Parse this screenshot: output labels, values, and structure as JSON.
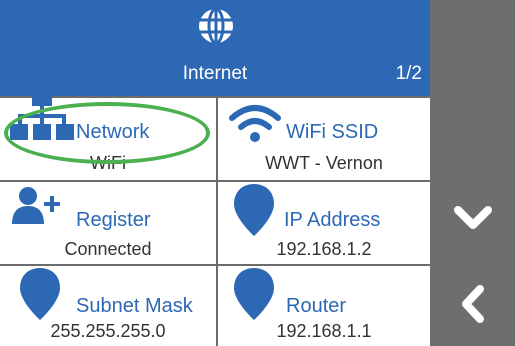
{
  "header": {
    "title": "Internet",
    "page_indicator": "1/2",
    "icon": "globe-icon"
  },
  "tiles": [
    {
      "label": "Network",
      "value": "WiFi",
      "icon": "network-icon",
      "highlighted": true
    },
    {
      "label": "WiFi SSID",
      "value": "WWT - Vernon",
      "icon": "wifi-icon"
    },
    {
      "label": "Register",
      "value": "Connected",
      "icon": "add-user-icon"
    },
    {
      "label": "IP Address",
      "value": "192.168.1.2",
      "icon": "location-pin-icon"
    },
    {
      "label": "Subnet Mask",
      "value": "255.255.255.0",
      "icon": "location-pin-icon"
    },
    {
      "label": "Router",
      "value": "192.168.1.1",
      "icon": "location-pin-icon"
    }
  ],
  "side_nav": {
    "down_icon": "chevron-down-icon",
    "back_icon": "chevron-left-icon"
  },
  "colors": {
    "header": "#2c68b4",
    "accent": "#2c68b4",
    "side_bar": "#6e6e6e",
    "highlight": "#4caf50"
  }
}
